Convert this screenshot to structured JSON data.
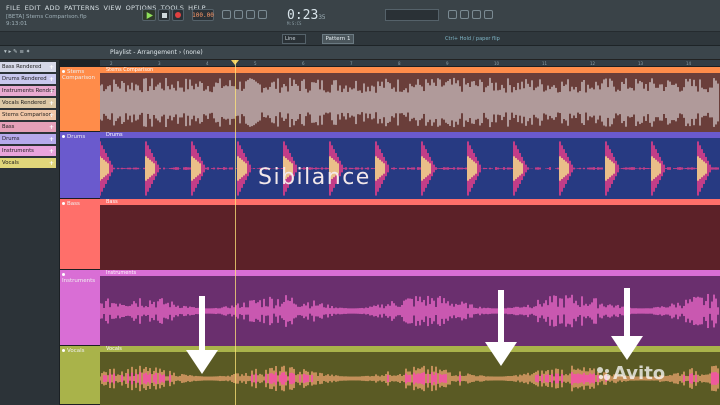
{
  "menu": [
    "FILE",
    "EDIT",
    "ADD",
    "PATTERNS",
    "VIEW",
    "OPTIONS",
    "TOOLS",
    "HELP"
  ],
  "subtitle": "[BETA] Stems Comparison.flp",
  "subtitle2": "9:13:01",
  "transport": {
    "tempo": "100.00",
    "time_main": "0:23",
    "time_small": "35",
    "time_sub": "M:S:CS"
  },
  "toolbar2": {
    "pattern": "Pattern 1",
    "line": "Line",
    "hint": "Ctrl+ Hold / paper flip"
  },
  "playlist_title": "Playlist - Arrangement › (none)",
  "browser_head": "▾ ▸ ✎ ≡ ✦",
  "browser_items": [
    {
      "label": "Bass Rendered",
      "color": "#d6d8e8"
    },
    {
      "label": "Drums Rendered",
      "color": "#c9c8ee"
    },
    {
      "label": "Instruments Render",
      "color": "#e8aad0"
    },
    {
      "label": "Vocals Rendered",
      "color": "#dcc9a6"
    },
    {
      "label": "Stems Comparison",
      "color": "#f0c6a6"
    },
    {
      "label": "Bass",
      "color": "#e5a0b8"
    },
    {
      "label": "Drums",
      "color": "#b6a9ec"
    },
    {
      "label": "Instruments",
      "color": "#e9a4dc"
    },
    {
      "label": "Vocals",
      "color": "#e0d67a"
    }
  ],
  "tracks": [
    {
      "name": "Stems Comparison",
      "clip": "Stems Comparison",
      "color": "#ff8c4a",
      "lane_bg": "#6a3e3a",
      "wave": "#d8cfd0"
    },
    {
      "name": "Drums",
      "clip": "Drums",
      "color": "#6a5acd",
      "lane_bg": "#273a82",
      "wave": "#ff3f8a"
    },
    {
      "name": "Bass",
      "clip": "Bass",
      "color": "#ff6f6a",
      "lane_bg": "#5c2128",
      "wave": "#d04050"
    },
    {
      "name": "Instruments",
      "clip": "Instruments",
      "color": "#d96ed5",
      "lane_bg": "#6a2f6e",
      "wave": "#ff6fd6"
    },
    {
      "name": "Vocals",
      "clip": "Vocals",
      "color": "#a9b34a",
      "lane_bg": "#5a5a24",
      "wave": "#ffb07a"
    }
  ],
  "ruler_ticks": [
    "2",
    "3",
    "4",
    "5",
    "6",
    "7",
    "8",
    "9",
    "10",
    "11",
    "12",
    "13",
    "14"
  ],
  "overlay_text": "Sibilance",
  "watermark": "Avito"
}
